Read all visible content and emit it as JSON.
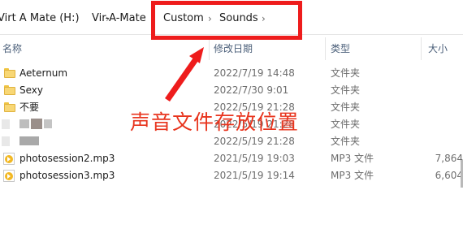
{
  "breadcrumb": {
    "items": [
      {
        "label": "Virt A Mate (H:)"
      },
      {
        "label": "Vir-A-Mate"
      },
      {
        "label": "Custom"
      },
      {
        "label": "Sounds"
      }
    ],
    "separator": "›"
  },
  "columns": {
    "name": "名称",
    "date": "修改日期",
    "type": "类型",
    "size": "大小"
  },
  "files": [
    {
      "name": "Aeternum",
      "date": "2022/7/19 14:48",
      "type": "文件夹",
      "size": "",
      "icon": "folder-icon"
    },
    {
      "name": "Sexy",
      "date": "2022/7/30 9:01",
      "type": "文件夹",
      "size": "",
      "icon": "folder-icon"
    },
    {
      "name": "不要",
      "date": "2022/5/19 21:28",
      "type": "文件夹",
      "size": "",
      "icon": "folder-icon"
    },
    {
      "name": "",
      "date": "2022/5/19 21:28",
      "type": "文件夹",
      "size": "",
      "icon": "folder-icon"
    },
    {
      "name": "",
      "date": "2022/5/19 21:28",
      "type": "文件夹",
      "size": "",
      "icon": "folder-icon"
    },
    {
      "name": "photosession2.mp3",
      "date": "2021/5/19 19:03",
      "type": "MP3 文件",
      "size": "7,864",
      "icon": "mp3-icon"
    },
    {
      "name": "photosession3.mp3",
      "date": "2021/5/19 19:14",
      "type": "MP3 文件",
      "size": "6,604",
      "icon": "mp3-icon"
    }
  ],
  "annotation": {
    "text": "声音文件存放位置",
    "color": "#e8341d"
  },
  "colors": {
    "highlight": "#ee1c1c",
    "folder": "#f8d775",
    "mp3": "#f2b824"
  }
}
